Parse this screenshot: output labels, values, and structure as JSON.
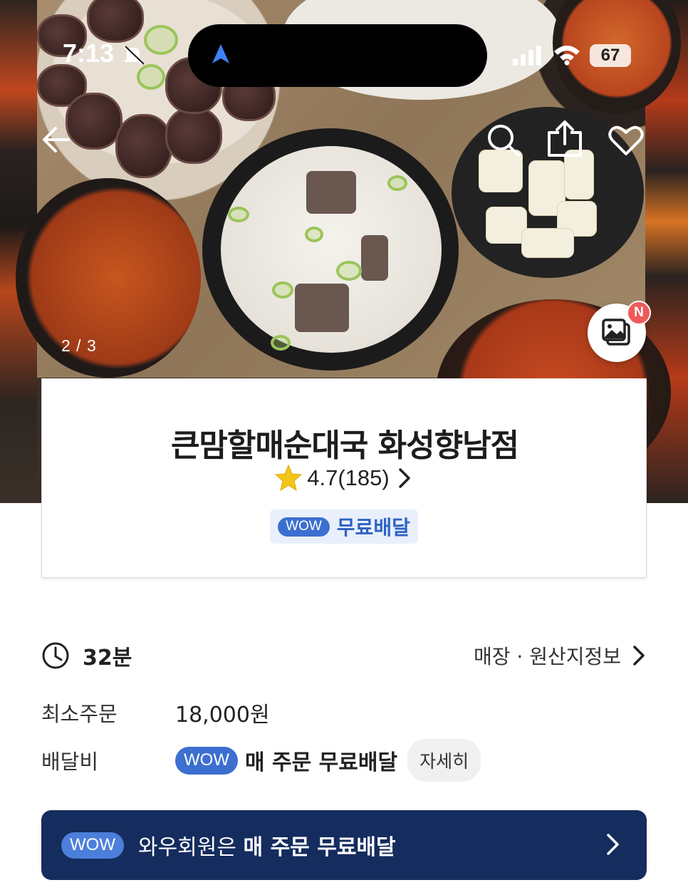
{
  "status_bar": {
    "time": "7:13",
    "battery": "67"
  },
  "hero": {
    "photo_counter": "2 / 3",
    "gallery_badge": "N"
  },
  "store": {
    "name": "큰맘할매순대국 화성향남점",
    "rating": "4.7(185)",
    "wow_label": "WOW",
    "free_delivery_label": "무료배달"
  },
  "details": {
    "delivery_time": "32분",
    "store_info_link": "매장 · 원산지정보",
    "min_order_label": "최소주문",
    "min_order_value": "18,000원",
    "delivery_fee_label": "배달비",
    "fee_wow": "WOW",
    "fee_text": "매 주문 무료배달",
    "detail_button": "자세히"
  },
  "banner": {
    "wow": "WOW",
    "text_prefix": "와우회원은",
    "text_bold": "매 주문 무료배달"
  },
  "colors": {
    "brand_blue": "#3c6fd0",
    "banner_navy": "#152c5e",
    "star": "#f5c518",
    "badge_red": "#ef5a5a"
  }
}
